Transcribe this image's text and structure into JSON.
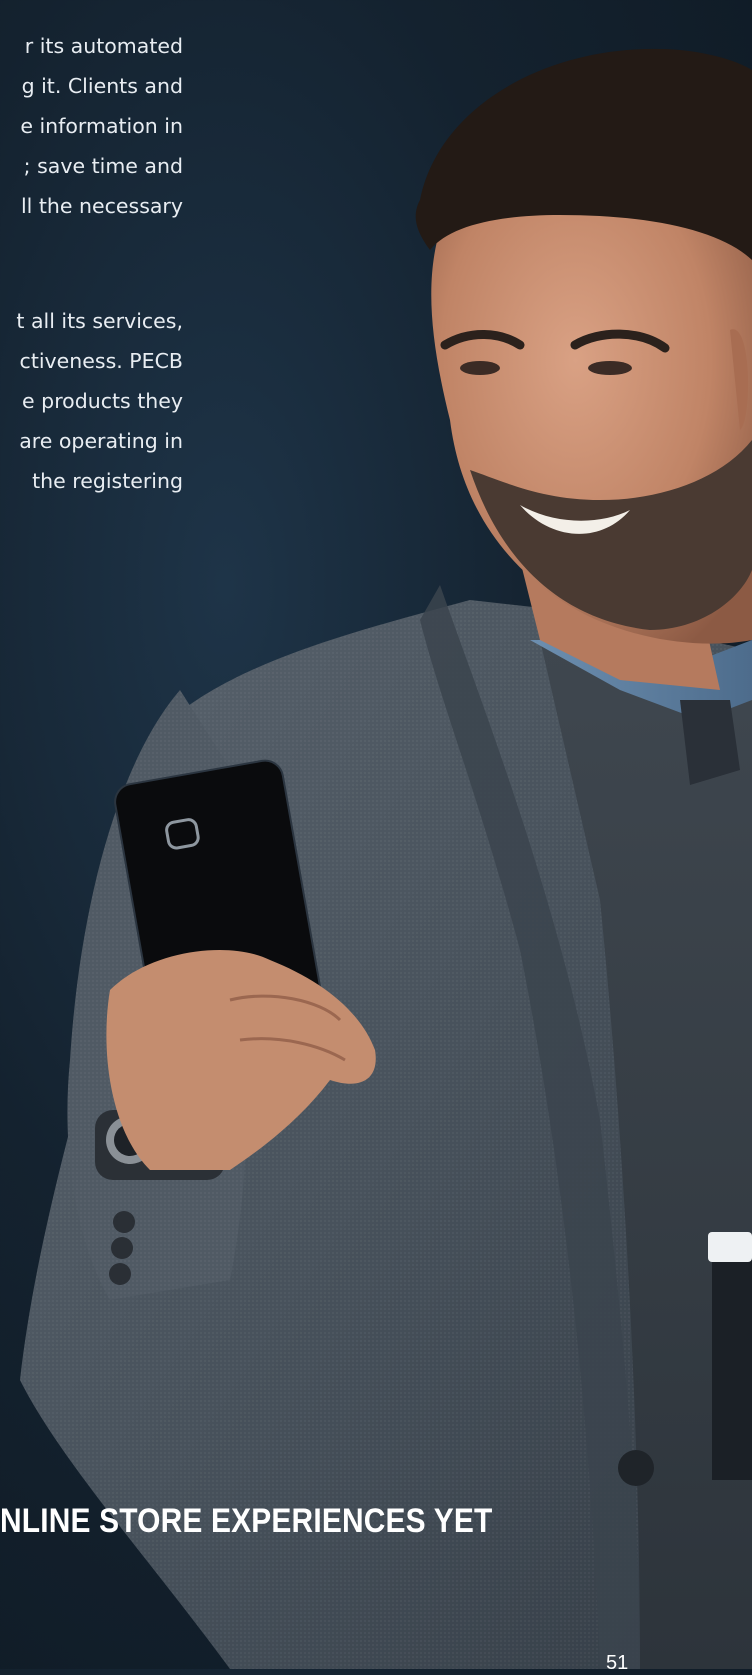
{
  "paragraph_1": [
    "r its automated",
    "g it. Clients and",
    "e information in",
    "; save time and",
    "ll the necessary"
  ],
  "paragraph_2": [
    "t all its services,",
    "ctiveness. PECB",
    "e products they",
    "are operating in",
    "the registering"
  ],
  "headline": "NLINE STORE EXPERIENCES YET",
  "page_number": "51",
  "colors": {
    "background": "#14222f",
    "jacket": "#4b5560",
    "text": "#e8edf2"
  },
  "image_subject": "man-smiling-at-smartphone"
}
